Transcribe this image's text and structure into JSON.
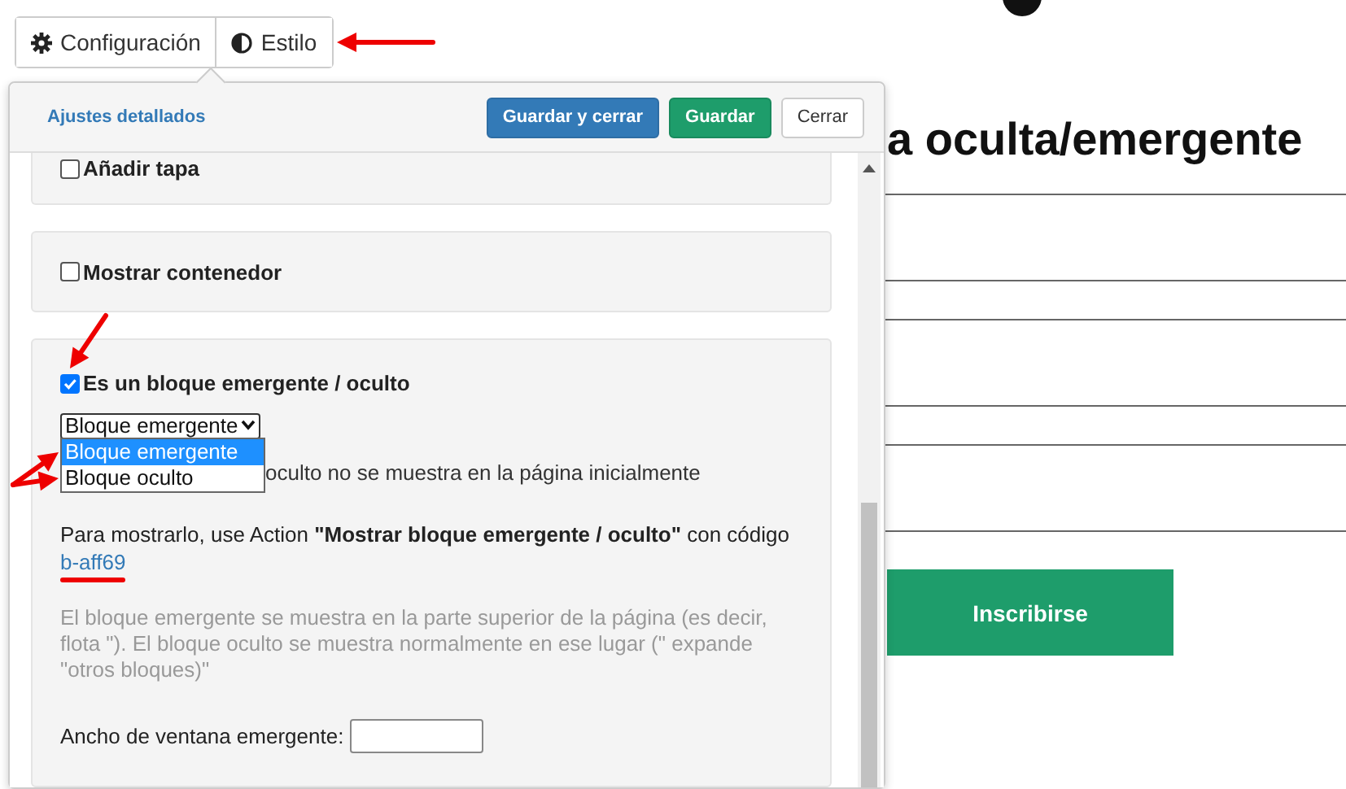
{
  "toolbar": {
    "tabs": [
      {
        "label": "Configuración"
      },
      {
        "label": "Estilo"
      }
    ]
  },
  "popover": {
    "link": "Ajustes detallados",
    "buttons": [
      {
        "label": "Guardar y cerrar",
        "kind": "primary"
      },
      {
        "label": "Guardar",
        "kind": "success"
      },
      {
        "label": "Cerrar",
        "kind": "default"
      }
    ],
    "sections": [
      {
        "checkbox": {
          "label": "Añadir tapa",
          "checked": false
        }
      },
      {
        "checkbox": {
          "label": "Mostrar contenedor",
          "checked": false
        }
      },
      {
        "checkbox": {
          "label": "Es un bloque emergente / oculto",
          "checked": true
        },
        "select": {
          "value": "Bloque emergente",
          "expanded": true,
          "options": [
            {
              "label": "Bloque emergente",
              "selected": true
            },
            {
              "label": "Bloque oculto",
              "selected": false
            }
          ]
        },
        "hint": "oculto no se muestra en la página inicialmente",
        "instruction": "Para mostrarlo, use Action **\"Mostrar bloque emergente / oculto\"** con código",
        "code_link": "b-aff69",
        "note": "El bloque emergente se muestra en la parte superior de la página (es decir, flota \"). El bloque oculto se muestra normalmente en ese lugar (\" expande \"otros bloques)\"",
        "width_field": {
          "label": "Ancho de ventana emergente:"
        }
      }
    ]
  },
  "page": {
    "heading": "a oculta/emergente",
    "button": "Inscribirse"
  }
}
